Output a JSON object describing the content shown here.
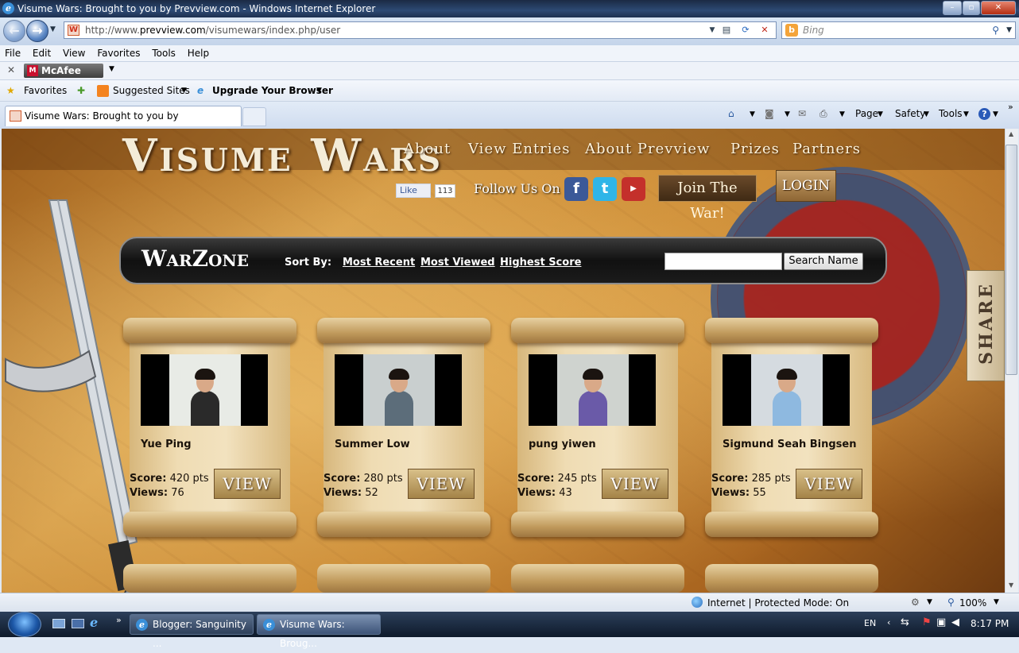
{
  "window": {
    "title": "Visume Wars: Brought to you by Prevview.com - Windows Internet Explorer"
  },
  "browser": {
    "url_prefix": "http://www.",
    "url_domain": "prevview.com",
    "url_path": "/visumewars/index.php/user",
    "search_placeholder": "Bing",
    "menu": [
      "File",
      "Edit",
      "View",
      "Favorites",
      "Tools",
      "Help"
    ],
    "mcafee_label": "McAfee",
    "favorites_label": "Favorites",
    "suggested_sites": "Suggested Sites",
    "upgrade_browser": "Upgrade Your Browser",
    "tab_title": "Visume Wars: Brought to you by Prevview.com",
    "toolbar": {
      "page": "Page",
      "safety": "Safety",
      "tools": "Tools"
    },
    "status": {
      "zone": "Internet | Protected Mode: On",
      "zoom": "100%"
    }
  },
  "site": {
    "logo": "Visume Wars",
    "nav": [
      "About",
      "View Entries",
      "About Prevview",
      "Prizes",
      "Partners"
    ],
    "fb_like": "Like",
    "fb_count": "113",
    "follow_us": "Follow Us On",
    "join_war": "Join The War!",
    "login": "LOGIN",
    "share": "SHARE",
    "warzone": {
      "title": "WarZone",
      "sort_by": "Sort By:",
      "sort_links": [
        "Most Recent",
        "Most Viewed",
        "Highest Score"
      ],
      "search_button": "Search Name"
    },
    "entries": [
      {
        "name": "Yue Ping",
        "score_label": "Score:",
        "score": "420 pts",
        "views_label": "Views:",
        "views": "76",
        "view": "VIEW",
        "shirt": "#2a2a2a",
        "bg": "#e8ebe6"
      },
      {
        "name": "Summer Low",
        "score_label": "Score:",
        "score": "280 pts",
        "views_label": "Views:",
        "views": "52",
        "view": "VIEW",
        "shirt": "#5c6d7a",
        "bg": "#c9cfcf"
      },
      {
        "name": "pung yiwen",
        "score_label": "Score:",
        "score": "245 pts",
        "views_label": "Views:",
        "views": "43",
        "view": "VIEW",
        "shirt": "#6a5aa8",
        "bg": "#cfd3cf"
      },
      {
        "name": "Sigmund Seah Bingsen",
        "score_label": "Score:",
        "score": "285 pts",
        "views_label": "Views:",
        "views": "55",
        "view": "VIEW",
        "shirt": "#8eb9e0",
        "bg": "#d5dbe0"
      }
    ]
  },
  "taskbar": {
    "items": [
      "Blogger: Sanguinity ...",
      "Visume Wars: Broug..."
    ],
    "lang": "EN",
    "time": "8:17 PM"
  }
}
